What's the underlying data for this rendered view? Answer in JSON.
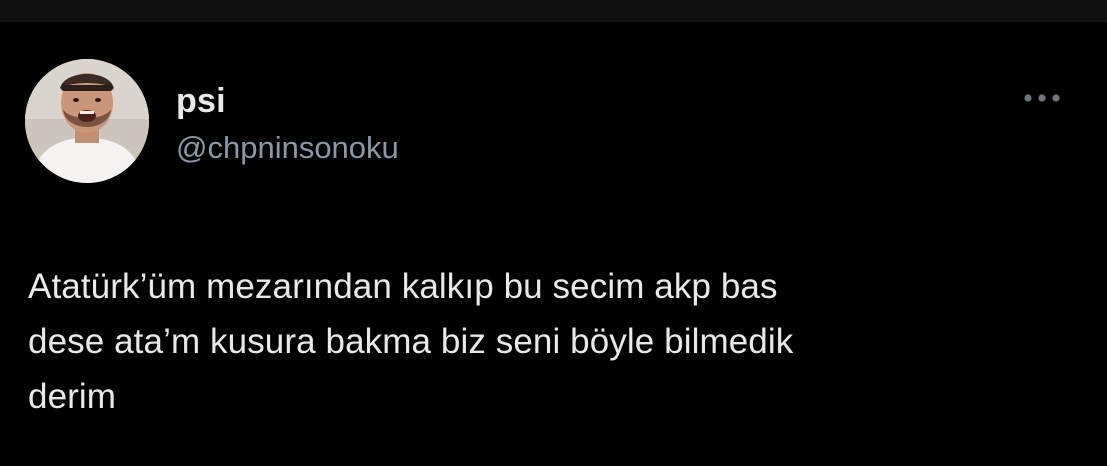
{
  "theme": {
    "background": "#000000",
    "top_band": "#111112",
    "text_primary": "#e7e9ea",
    "text_secondary": "#8b98a5"
  },
  "tweet": {
    "author": {
      "display_name": "psi",
      "handle": "@chpninsonoku",
      "avatar_icon": "profile-photo-avatar"
    },
    "more_icon": "more-horizontal-icon",
    "text_lines": [
      "Atatürk’üm mezarından kalkıp bu secim akp bas",
      "dese ata’m kusura bakma biz seni böyle bilmedik",
      "derim"
    ]
  }
}
